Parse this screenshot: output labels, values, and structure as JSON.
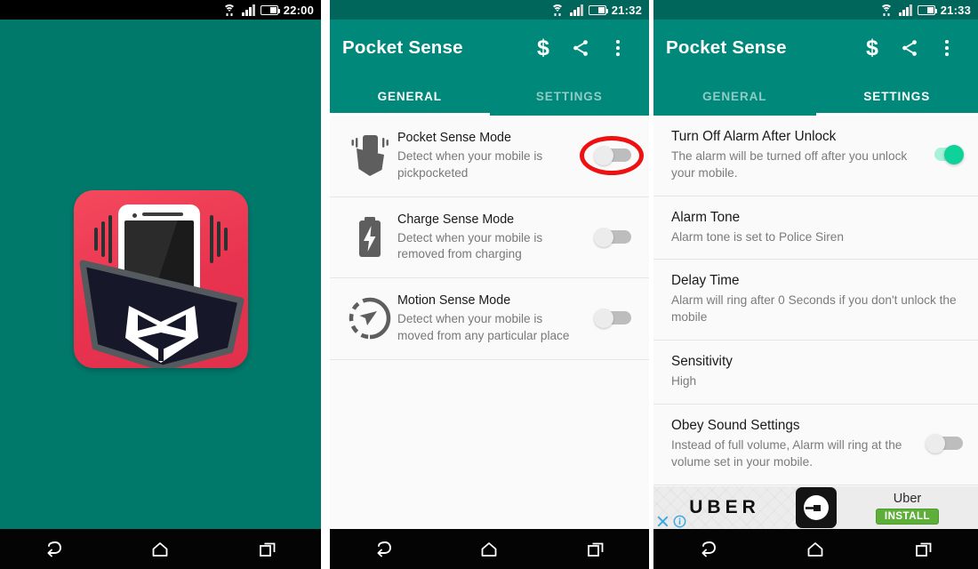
{
  "panels": {
    "splash": {
      "name": "app-splash-screen",
      "statusbar": {
        "time": "22:00",
        "style": "dark"
      },
      "background_color": "#00796b",
      "logo_alt": "Pocket Sense app icon"
    },
    "general": {
      "name": "general-tab-screen",
      "statusbar": {
        "time": "21:32",
        "style": "teal"
      },
      "appbar": {
        "title": "Pocket Sense",
        "dollar_label": "$",
        "share_icon": "share-icon",
        "overflow_icon": "more-vert-icon"
      },
      "tabs": [
        {
          "label": "GENERAL",
          "active": true
        },
        {
          "label": "SETTINGS",
          "active": false
        }
      ],
      "rows": [
        {
          "icon": "pocket-phone-icon",
          "title": "Pocket Sense Mode",
          "subtitle": "Detect when your mobile is pickpocketed",
          "toggle_on": false,
          "highlighted": true
        },
        {
          "icon": "battery-bolt-icon",
          "title": "Charge Sense Mode",
          "subtitle": "Detect when your mobile is removed from charging",
          "toggle_on": false,
          "highlighted": false
        },
        {
          "icon": "compass-icon",
          "title": "Motion Sense Mode",
          "subtitle": "Detect when your mobile is moved from any particular place",
          "toggle_on": false,
          "highlighted": false
        }
      ]
    },
    "settings": {
      "name": "settings-tab-screen",
      "statusbar": {
        "time": "21:33",
        "style": "teal"
      },
      "appbar": {
        "title": "Pocket Sense",
        "dollar_label": "$",
        "share_icon": "share-icon",
        "overflow_icon": "more-vert-icon"
      },
      "tabs": [
        {
          "label": "GENERAL",
          "active": false
        },
        {
          "label": "SETTINGS",
          "active": true
        }
      ],
      "rows": [
        {
          "title": "Turn Off Alarm After Unlock",
          "subtitle": "The alarm will be turned off after you unlock your mobile.",
          "has_toggle": true,
          "toggle_on": true
        },
        {
          "title": "Alarm Tone",
          "subtitle": "Alarm tone is set to Police Siren",
          "has_toggle": false,
          "toggle_on": false
        },
        {
          "title": "Delay Time",
          "subtitle": "Alarm will ring after 0 Seconds if you don't unlock the mobile",
          "has_toggle": false,
          "toggle_on": false
        },
        {
          "title": "Sensitivity",
          "subtitle": "High",
          "has_toggle": false,
          "toggle_on": false
        },
        {
          "title": "Obey Sound Settings",
          "subtitle": "Instead of full volume, Alarm will ring at the volume set in your mobile.",
          "has_toggle": true,
          "toggle_on": false
        }
      ],
      "ad": {
        "wordmark": "UBER",
        "app_name": "Uber",
        "install_label": "INSTALL",
        "close_icon": "close-icon",
        "info_icon": "info-icon"
      }
    }
  },
  "navbar": {
    "back_icon": "back-arrow-icon",
    "home_icon": "home-icon",
    "recents_icon": "recent-apps-icon"
  },
  "colors": {
    "teal_primary": "#00897b",
    "teal_status": "#00655a",
    "teal_splash": "#00796b",
    "toggle_on": "#0ed29a",
    "toggle_off_track": "#bdbdbd",
    "highlight_ring": "#ee1111",
    "install_green": "#5eae3a",
    "logo_red": "#e8334f"
  }
}
